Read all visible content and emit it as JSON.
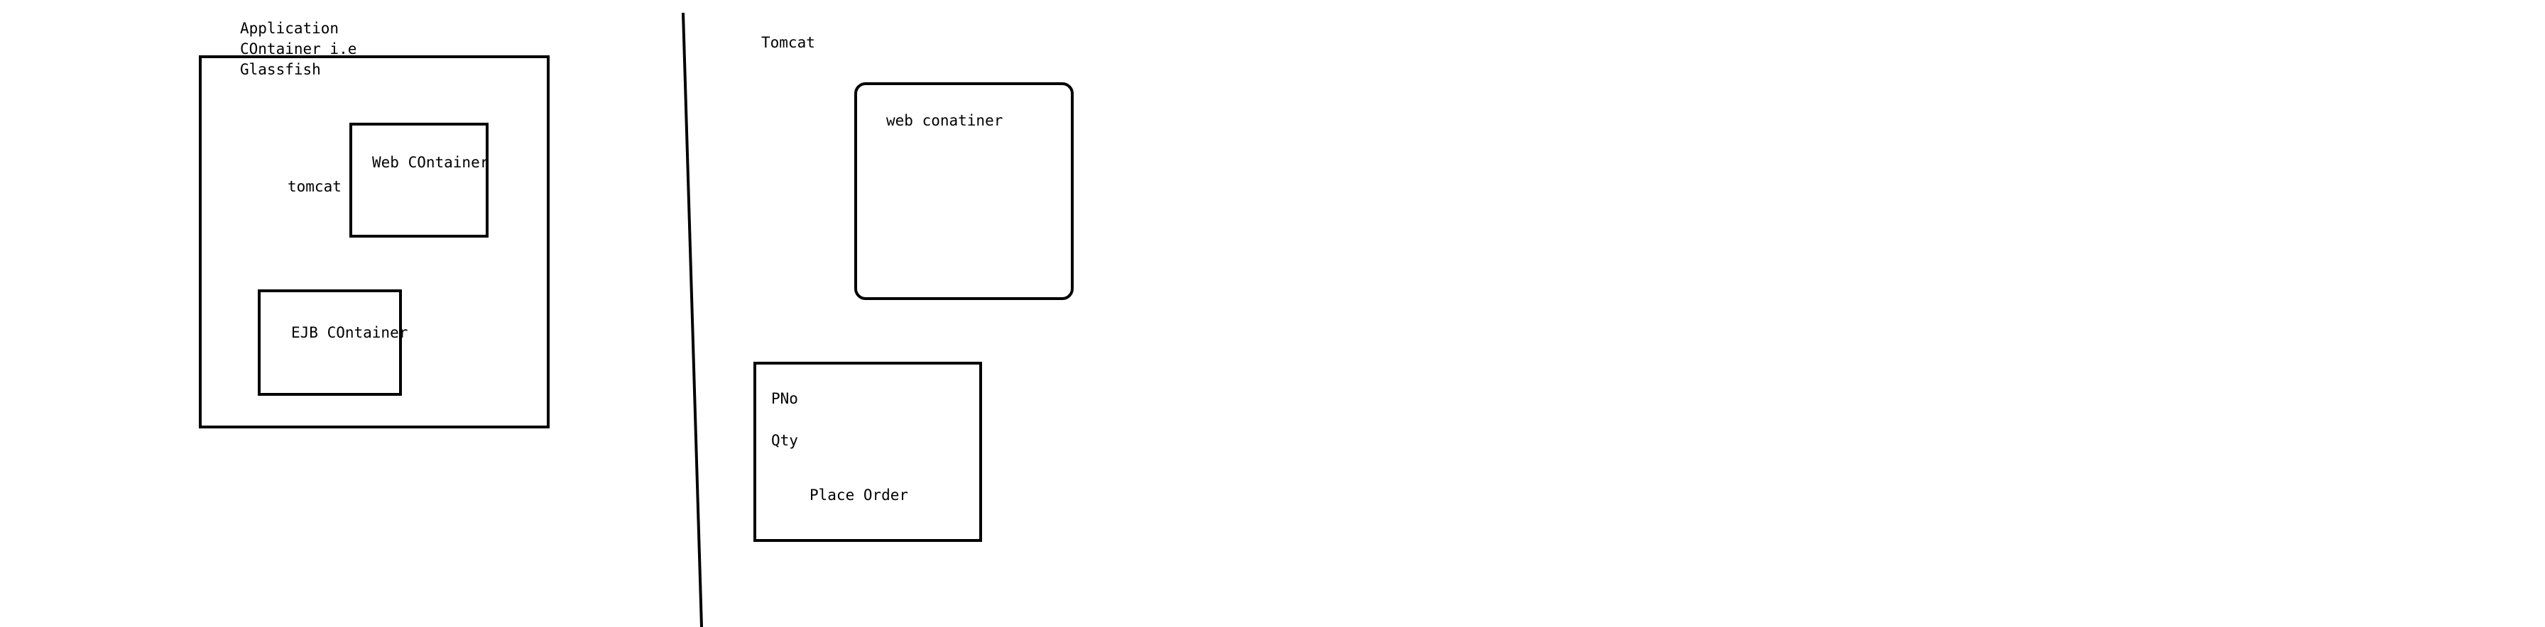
{
  "left_panel": {
    "app_container_label_lines": [
      "Application",
      "COntainer i.e",
      "Glassfish"
    ],
    "tomcat_label": "tomcat",
    "web_container_label": "Web COntainer",
    "ejb_container_label": "EJB COntainer"
  },
  "right_panel": {
    "tomcat_title": "Tomcat",
    "web_container_label": "web conatiner",
    "form": {
      "pno_label": "PNo",
      "qty_label": "Qty",
      "place_order_label": "Place Order"
    }
  },
  "colors": {
    "stroke": "#000000",
    "background": "#ffffff"
  }
}
